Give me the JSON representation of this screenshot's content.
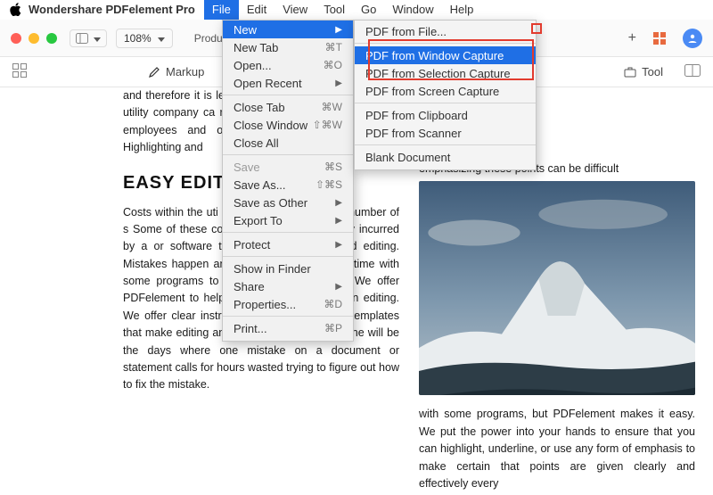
{
  "menubar": {
    "app_name": "Wondershare PDFelement Pro",
    "items": [
      "File",
      "Edit",
      "View",
      "Tool",
      "Go",
      "Window",
      "Help"
    ],
    "active_index": 0
  },
  "window": {
    "zoom": "108%",
    "tab_label": "Produ",
    "tb_tool_label": "Tool"
  },
  "subbar": {
    "markup": "Markup"
  },
  "file_menu": {
    "items": [
      {
        "label": "New",
        "sc": "",
        "arrow": true,
        "hi": true
      },
      {
        "label": "New Tab",
        "sc": "⌘T"
      },
      {
        "label": "Open...",
        "sc": "⌘O"
      },
      {
        "label": "Open Recent",
        "sc": "",
        "arrow": true
      },
      {
        "divider": true
      },
      {
        "label": "Close Tab",
        "sc": "⌘W"
      },
      {
        "label": "Close Window",
        "sc": "⇧⌘W"
      },
      {
        "label": "Close All"
      },
      {
        "divider": true
      },
      {
        "label": "Save",
        "sc": "⌘S",
        "dim": true
      },
      {
        "label": "Save As...",
        "sc": "⇧⌘S"
      },
      {
        "label": "Save as Other",
        "arrow": true
      },
      {
        "label": "Export To",
        "arrow": true
      },
      {
        "divider": true
      },
      {
        "label": "Protect",
        "arrow": true
      },
      {
        "divider": true
      },
      {
        "label": "Show in Finder"
      },
      {
        "label": "Share",
        "arrow": true
      },
      {
        "label": "Properties...",
        "sc": "⌘D"
      },
      {
        "divider": true
      },
      {
        "label": "Print...",
        "sc": "⌘P"
      }
    ]
  },
  "new_submenu": {
    "items": [
      {
        "label": "PDF from File..."
      },
      {
        "divider": true
      },
      {
        "label": "PDF from Window Capture",
        "hi": true
      },
      {
        "label": "PDF from Selection Capture"
      },
      {
        "label": "PDF from Screen Capture"
      },
      {
        "divider": true
      },
      {
        "label": "PDF from Clipboard"
      },
      {
        "label": "PDF from Scanner"
      },
      {
        "divider": true
      },
      {
        "label": "Blank Document"
      }
    ]
  },
  "doc": {
    "left_top": "and therefore it is le                                                                                                t  factor specific tasks. The                                                                                                  ing out utility company ca                                                                                                   rs  and they will have to co                                                                                                  hat are employees and over                                                    ore important than others. Highlighting and",
    "right_top": "emphasizing these points can be difficult",
    "heading": "EASY EDITING",
    "left_body": "Costs within the uti energy field can con any number of s Some of these co essential, but othe purely incurred by a or software that w made to offer fluid editing. Mistakes happen and it can take up a lot of time with some programs to fix and edit documents. We offer PDFelement to help reduce the time spent on editing. We offer clear instructions and easy to use templates that make editing any document a breeze. Gone will be the days where one mistake on a document or statement calls for hours wasted trying to figure out how to fix the mistake.",
    "right_body": "with some programs, but PDFelement makes it easy. We put the power into your hands to ensure that you can highlight, underline, or use any form of emphasis to make certain that points are given clearly and effectively every"
  }
}
